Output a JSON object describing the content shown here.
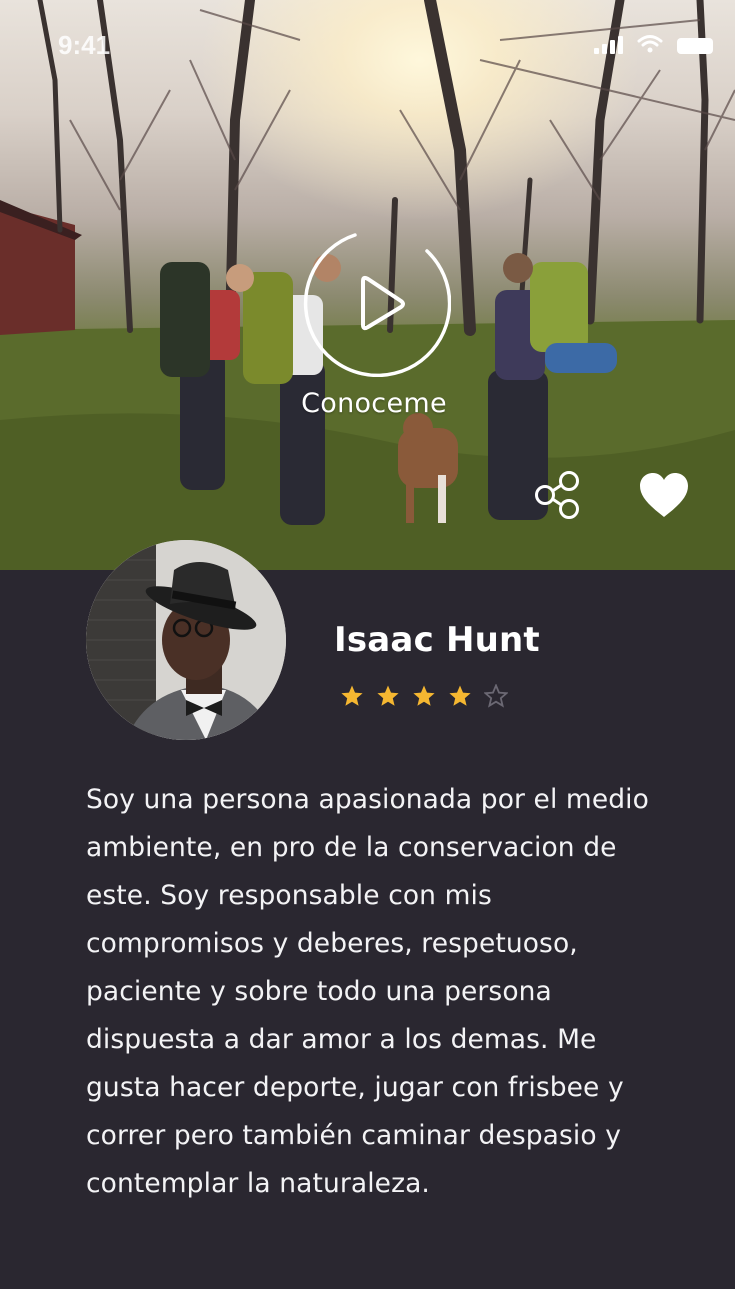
{
  "status_bar": {
    "time": "9:41"
  },
  "hero": {
    "video_caption": "Conoceme",
    "play_icon": "play-icon",
    "share_icon": "share-icon",
    "favorite_icon": "heart-icon"
  },
  "profile": {
    "name": "Isaac Hunt",
    "rating": 4,
    "rating_max": 5,
    "star_filled_color": "#f5b731",
    "star_empty_color": "#6b6873",
    "bio": "Soy una persona apasionada por el medio ambiente, en pro de la conservacion de este. Soy responsable con mis compromisos y deberes, respetuoso, paciente y sobre todo una persona dispuesta a dar amor a los demas. Me gusta hacer deporte, jugar con frisbee y correr pero también caminar despasio y contemplar la naturaleza."
  },
  "colors": {
    "background": "#2a2730",
    "text": "#ffffff"
  }
}
